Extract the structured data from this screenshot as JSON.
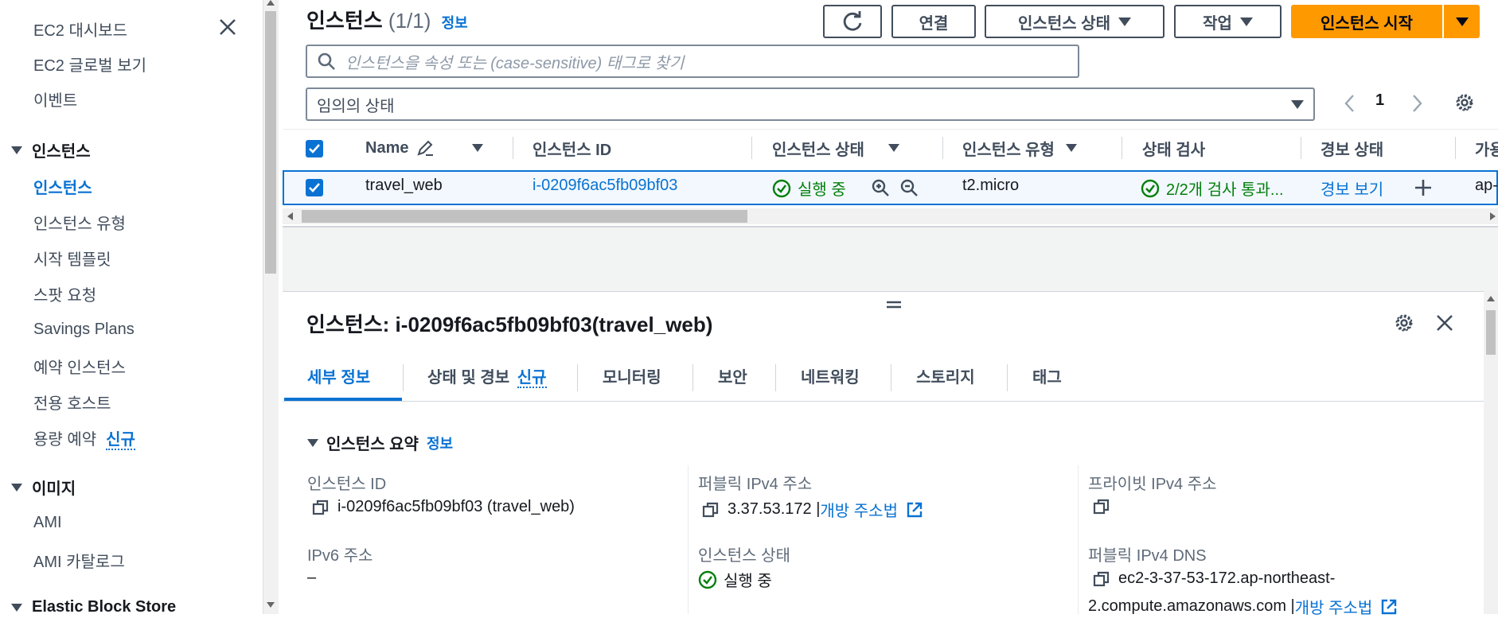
{
  "sidebar": {
    "items": [
      {
        "label": "EC2 대시보드"
      },
      {
        "label": "EC2 글로벌 보기"
      },
      {
        "label": "이벤트"
      }
    ],
    "sections": [
      {
        "title": "인스턴스",
        "items": [
          "인스턴스",
          "인스턴스 유형",
          "시작 템플릿",
          "스팟 요청",
          "Savings Plans",
          "예약 인스턴스",
          "전용 호스트",
          "용량 예약"
        ]
      },
      {
        "title": "이미지",
        "items": [
          "AMI",
          "AMI 카탈로그"
        ]
      },
      {
        "title": "Elastic Block Store"
      }
    ],
    "new_badge": "신규"
  },
  "header": {
    "title": "인스턴스",
    "count": "(1/1)",
    "info_link": "정보",
    "connect_label": "연결",
    "state_label": "인스턴스 상태",
    "actions_label": "작업",
    "launch_label": "인스턴스 시작"
  },
  "search": {
    "placeholder": "인스턴스을 속성 또는 (case-sensitive) 태그로 찾기"
  },
  "filter": {
    "state_value": "임의의 상태"
  },
  "pagination": {
    "page": "1"
  },
  "table": {
    "columns": [
      "Name",
      "인스턴스 ID",
      "인스턴스 상태",
      "인스턴스 유형",
      "상태 검사",
      "경보 상태",
      "가용"
    ],
    "rows": [
      {
        "name": "travel_web",
        "instance_id": "i-0209f6ac5fb09bf03",
        "state": "실행 중",
        "type": "t2.micro",
        "status_check": "2/2개 검사 통과...",
        "alarm": "경보 보기",
        "az": "ap-"
      }
    ]
  },
  "detail": {
    "title": "인스턴스: i-0209f6ac5fb09bf03(travel_web)",
    "tabs": [
      "세부 정보",
      "상태 및 경보",
      "모니터링",
      "보안",
      "네트워킹",
      "스토리지",
      "태그"
    ],
    "tab_new_badge": "신규",
    "summary_title": "인스턴스 요약",
    "summary_info": "정보",
    "fields": {
      "instance_id_label": "인스턴스 ID",
      "instance_id_value": "i-0209f6ac5fb09bf03 (travel_web)",
      "public_ipv4_label": "퍼블릭 IPv4 주소",
      "public_ipv4_value": "3.37.53.172 |",
      "public_ipv4_link": "개방 주소법",
      "private_ipv4_label": "프라이빗 IPv4 주소",
      "ipv6_label": "IPv6 주소",
      "ipv6_value": "–",
      "state_label": "인스턴스 상태",
      "state_value": "실행 중",
      "public_dns_label": "퍼블릭 IPv4 DNS",
      "public_dns_line1": "ec2-3-37-53-172.ap-northeast-",
      "public_dns_line2": "2.compute.amazonaws.com |",
      "public_dns_link": "개방 주소법"
    }
  },
  "colors": {
    "accent": "#0972d3",
    "primary_button": "#ff9900",
    "success": "#037f0c"
  }
}
